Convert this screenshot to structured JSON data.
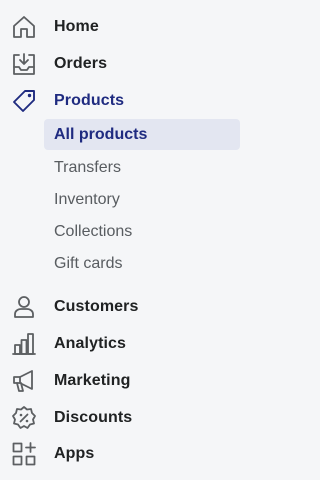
{
  "nav": {
    "items": [
      {
        "label": "Home",
        "icon": "home-icon"
      },
      {
        "label": "Orders",
        "icon": "orders-inbox-icon"
      },
      {
        "label": "Products",
        "icon": "tag-icon",
        "active": true
      },
      {
        "label": "Customers",
        "icon": "person-icon"
      },
      {
        "label": "Analytics",
        "icon": "bar-chart-icon"
      },
      {
        "label": "Marketing",
        "icon": "megaphone-icon"
      },
      {
        "label": "Discounts",
        "icon": "discount-badge-icon"
      },
      {
        "label": "Apps",
        "icon": "apps-grid-icon"
      }
    ],
    "products_sub": [
      {
        "label": "All products",
        "selected": true
      },
      {
        "label": "Transfers"
      },
      {
        "label": "Inventory"
      },
      {
        "label": "Collections"
      },
      {
        "label": "Gift cards"
      }
    ]
  },
  "colors": {
    "background": "#f5f6f8",
    "icon": "#5c5f62",
    "active_accent": "#1f2b80",
    "selected_bg": "#e3e6f1"
  }
}
